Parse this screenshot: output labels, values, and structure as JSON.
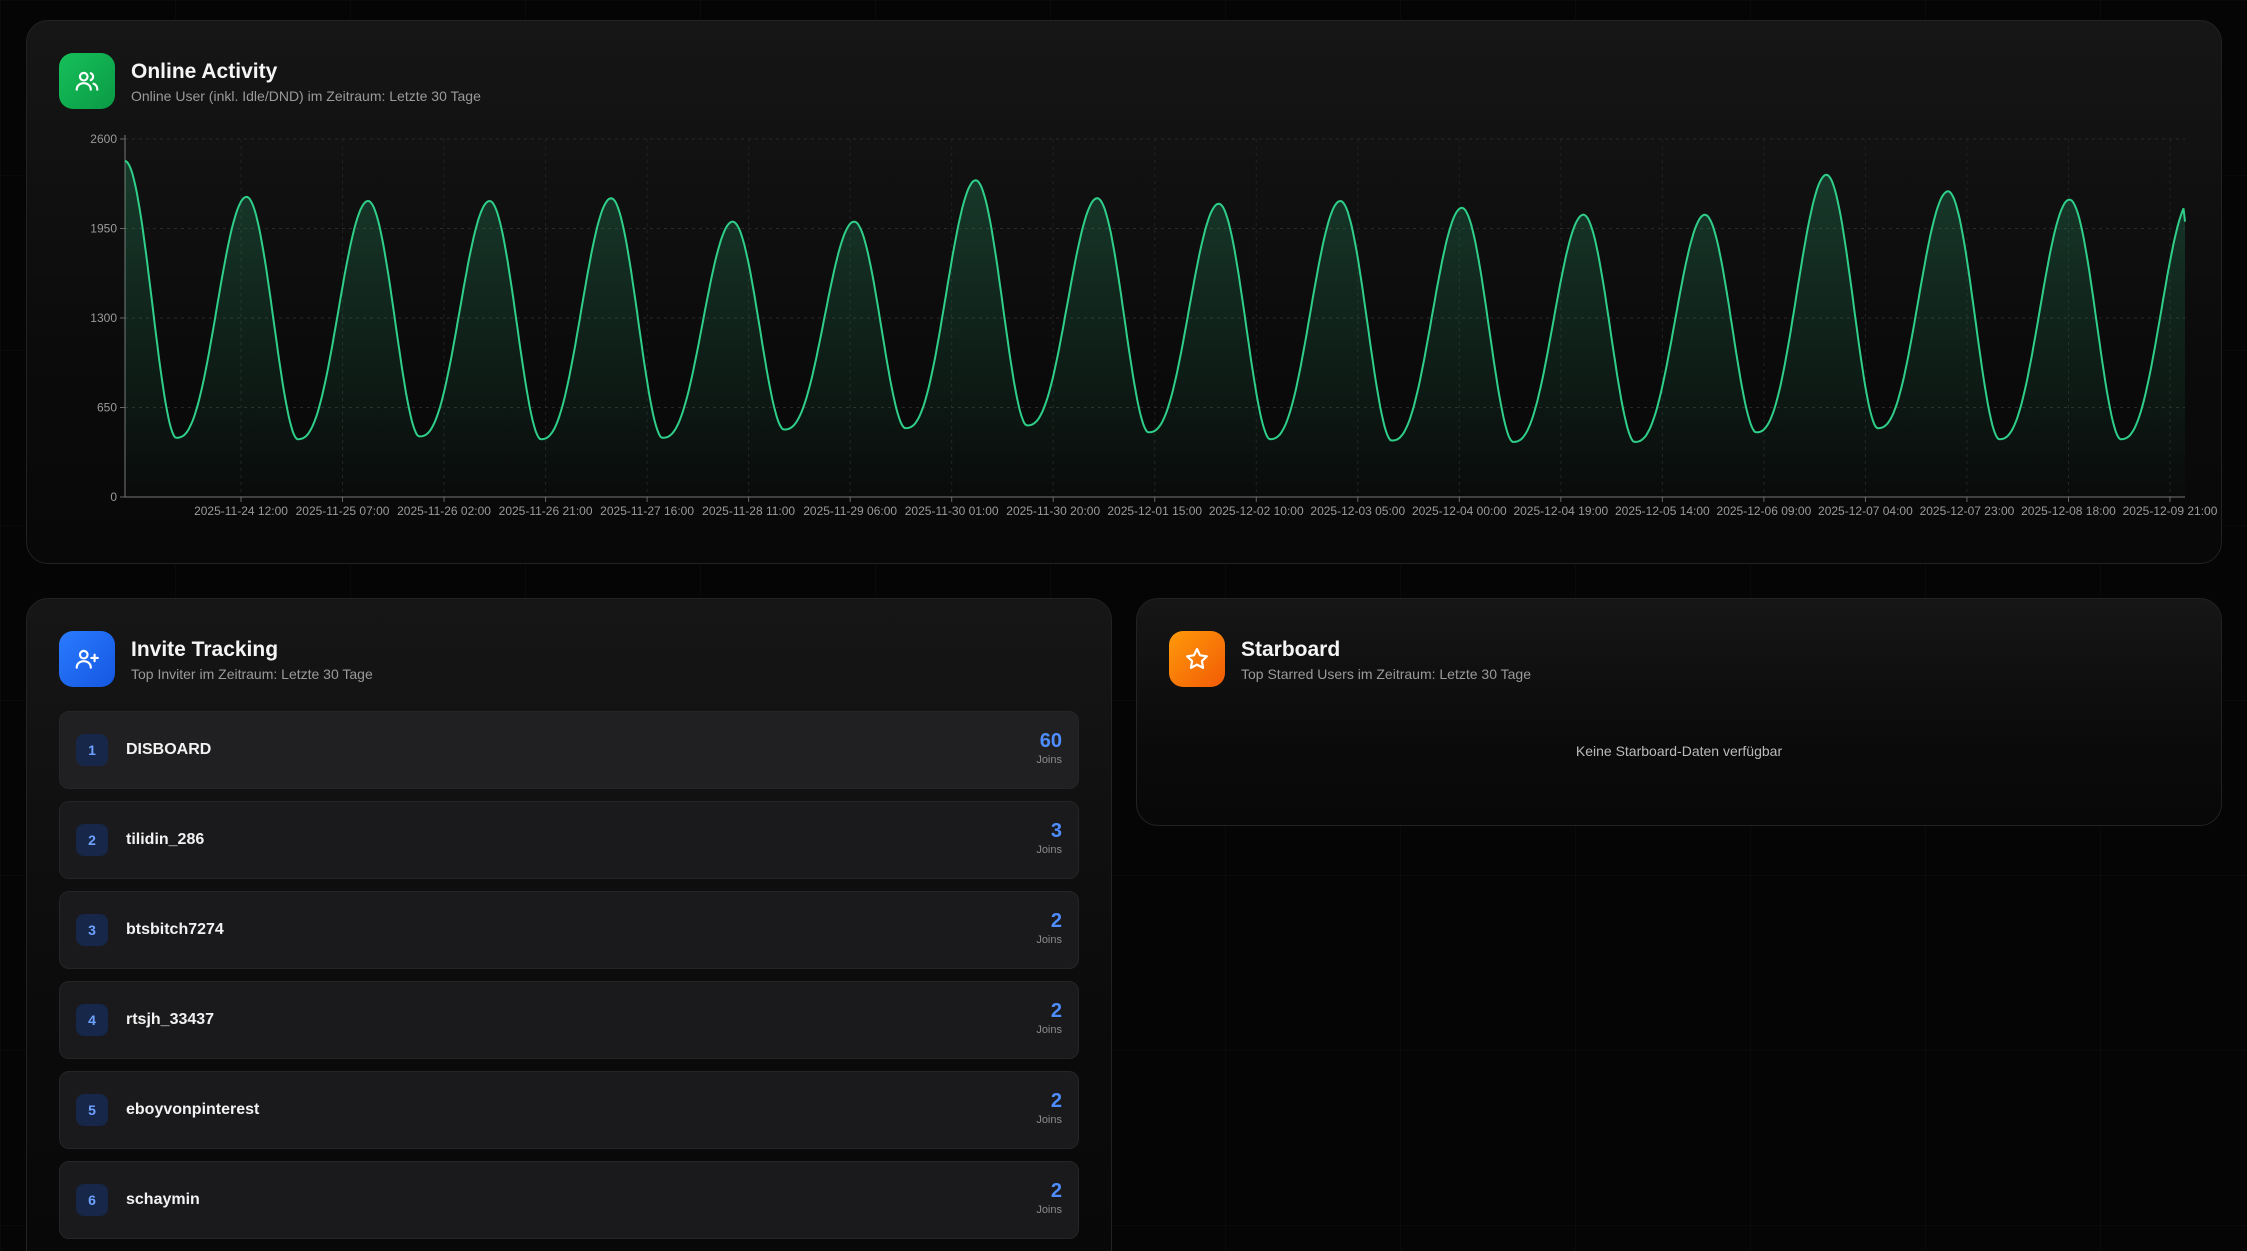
{
  "activity": {
    "title": "Online Activity",
    "subtitle": "Online User (inkl. Idle/DND) im Zeitraum: Letzte 30 Tage",
    "icon": "users-icon",
    "accent": "#16c05a"
  },
  "chart_data": {
    "type": "area",
    "title": "",
    "xlabel": "",
    "ylabel": "",
    "ylim": [
      0,
      2600
    ],
    "yticks": [
      0,
      650,
      1300,
      1950,
      2600
    ],
    "grid": true,
    "line_color": "#2fcf8a",
    "x_tick_labels": [
      "2025-11-24 12:00",
      "2025-11-25 07:00",
      "2025-11-26 02:00",
      "2025-11-26 21:00",
      "2025-11-27 16:00",
      "2025-11-28 11:00",
      "2025-11-29 06:00",
      "2025-11-30 01:00",
      "2025-11-30 20:00",
      "2025-12-01 15:00",
      "2025-12-02 10:00",
      "2025-12-03 05:00",
      "2025-12-04 00:00",
      "2025-12-04 19:00",
      "2025-12-05 14:00",
      "2025-12-06 09:00",
      "2025-12-07 04:00",
      "2025-12-07 23:00",
      "2025-12-08 18:00",
      "2025-12-09 21:00"
    ],
    "series": [
      {
        "daily_peaks": [
          2440,
          2180,
          2150,
          2150,
          2170,
          2000,
          2000,
          2300,
          2170,
          2130,
          2150,
          2100,
          2050,
          2050,
          2340,
          2220,
          2160
        ],
        "daily_troughs": [
          430,
          420,
          440,
          420,
          430,
          490,
          500,
          520,
          470,
          420,
          410,
          400,
          400,
          470,
          500,
          420,
          420
        ],
        "last_value": 2000
      }
    ]
  },
  "invites": {
    "title": "Invite Tracking",
    "subtitle": "Top Inviter im Zeitraum: Letzte 30 Tage",
    "icon": "user-plus-icon",
    "joins_label": "Joins",
    "rows": [
      {
        "rank": "1",
        "name": "DISBOARD",
        "count": "60"
      },
      {
        "rank": "2",
        "name": "tilidin_286",
        "count": "3"
      },
      {
        "rank": "3",
        "name": "btsbitch7274",
        "count": "2"
      },
      {
        "rank": "4",
        "name": "rtsjh_33437",
        "count": "2"
      },
      {
        "rank": "5",
        "name": "eboyvonpinterest",
        "count": "2"
      },
      {
        "rank": "6",
        "name": "schaymin",
        "count": "2"
      }
    ]
  },
  "starboard": {
    "title": "Starboard",
    "subtitle": "Top Starred Users im Zeitraum: Letzte 30 Tage",
    "icon": "star-icon",
    "empty_message": "Keine Starboard-Daten verfügbar"
  }
}
